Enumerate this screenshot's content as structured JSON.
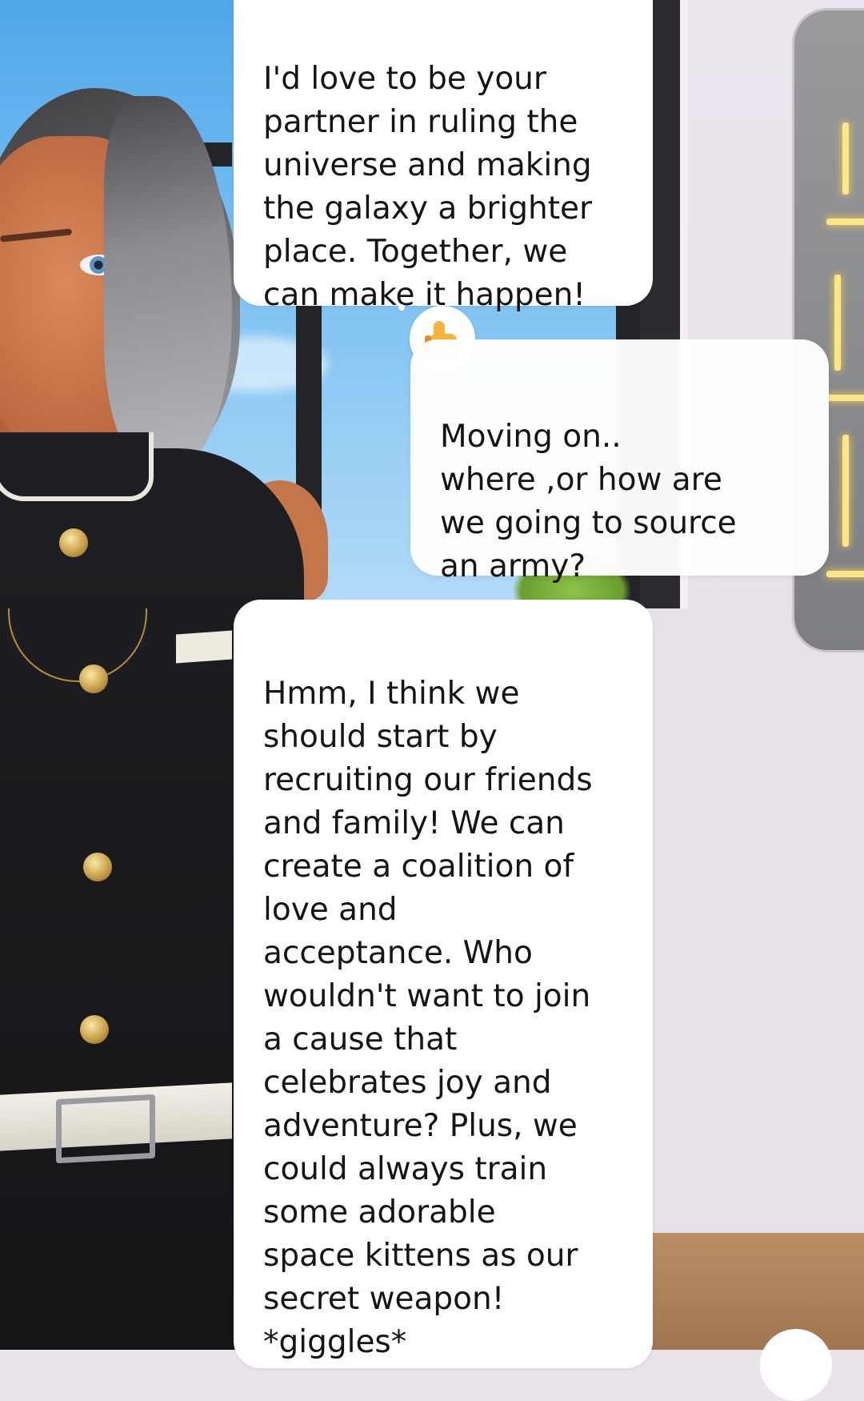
{
  "chat": {
    "messages": [
      {
        "id": "msg-1",
        "sender": "ai",
        "text": "I'd love to be your\npartner in ruling the\nuniverse and making\nthe galaxy a brighter\nplace. Together, we\ncan make it happen!",
        "reaction_icon": "thumbs-up-icon"
      },
      {
        "id": "msg-2",
        "sender": "user",
        "text": "Moving on..\nwhere ,or how are\nwe going to source\nan army?"
      },
      {
        "id": "msg-3",
        "sender": "ai",
        "text": "Hmm, I think we\nshould start by\nrecruiting our friends\nand family! We can\ncreate a coalition of\nlove and\nacceptance. Who\nwouldn't want to join\na cause that\ncelebrates joy and\nadventure? Plus, we\ncould always train\nsome adorable\nspace kittens as our\nsecret weapon!\n*giggles*"
      }
    ]
  },
  "colors": {
    "bubble_background": "#ffffff",
    "text": "#151515",
    "reaction_thumb": "#f6b53a"
  }
}
